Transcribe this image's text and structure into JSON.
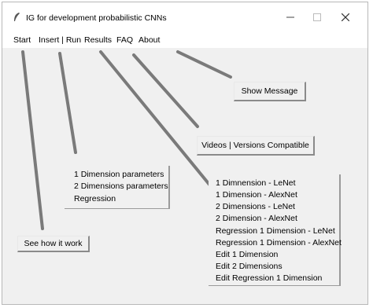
{
  "window": {
    "title": "IG for development probabilistic CNNs",
    "icons": {
      "app": "feather-icon",
      "minimize": "minimize-icon",
      "maximize": "maximize-icon",
      "close": "close-icon"
    }
  },
  "menubar": {
    "items": [
      "Start",
      "Insert | Run",
      "Results",
      "FAQ",
      "About"
    ]
  },
  "insert_menu": {
    "items": [
      "1 Dimension parameters",
      "2 Dimensions parameters",
      "Regression"
    ]
  },
  "results_menu": {
    "items": [
      "1 Dimnension - LeNet",
      "1 Dimension - AlexNet",
      "2 Dimensions - LeNet",
      "2 Dimension - AlexNet",
      "Regression 1 Dimension - LeNet",
      "Regression 1 Dimension - AlexNet",
      "Edit 1 Dimension",
      "Edit 2 Dimensions",
      "Edit Regression 1 Dimension"
    ]
  },
  "buttons": {
    "see_how": "See how it work",
    "show_message": "Show Message",
    "videos": "Videos | Versions Compatible"
  }
}
